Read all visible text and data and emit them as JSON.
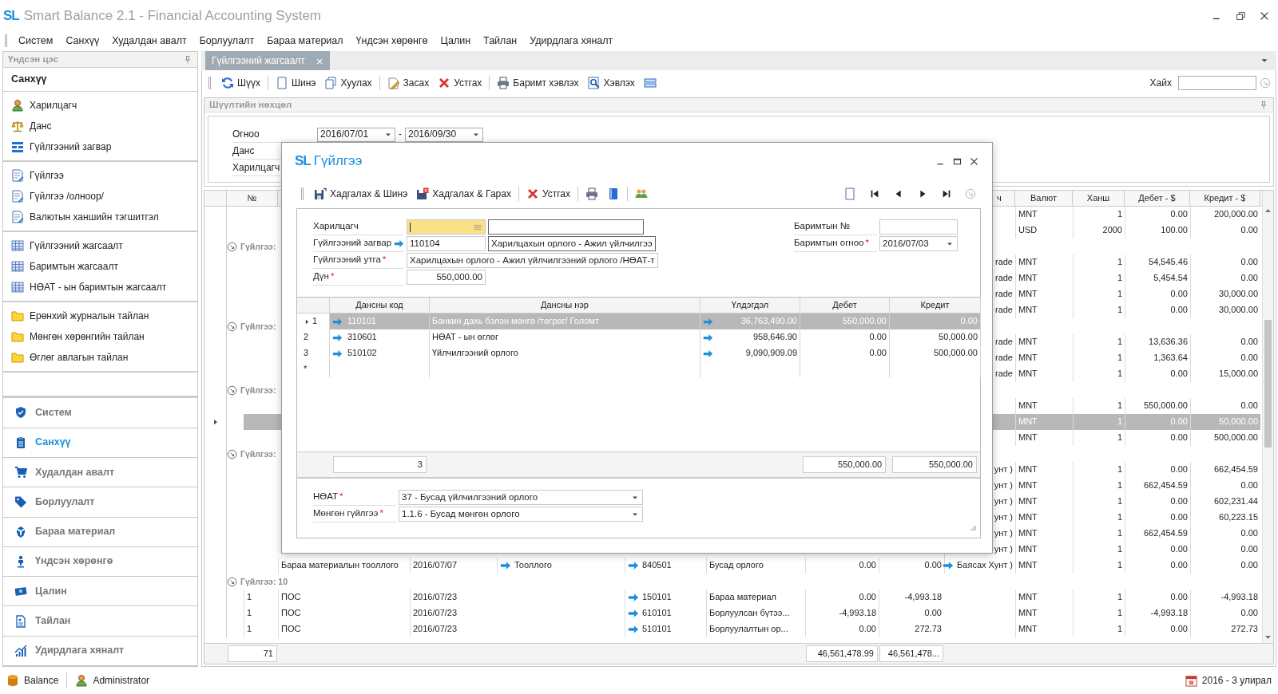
{
  "window": {
    "logo": "SL",
    "title": "Smart Balance 2.1 - Financial Accounting System"
  },
  "menu": [
    "Систем",
    "Санхүү",
    "Худалдан авалт",
    "Борлуулалт",
    "Бараа материал",
    "Үндсэн хөрөнгө",
    "Цалин",
    "Тайлан",
    "Удирдлага хяналт"
  ],
  "sidebar": {
    "header": "Үндсэн цэс",
    "section": "Санхүү",
    "groups": [
      [
        "Харилцагч",
        "Данс",
        "Гүйлгээний загвар"
      ],
      [
        "Гүйлгээ",
        "Гүйлгээ /олноор/",
        "Валютын ханшийн тэгшитгэл"
      ],
      [
        "Гүйлгээний жагсаалт",
        "Баримтын жагсаалт",
        "НӨАТ - ын баримтын жагсаалт"
      ],
      [
        "Ерөнхий журналын тайлан",
        "Мөнгөн хөрөнгийн тайлан",
        "Өглөг авлагын тайлан"
      ]
    ],
    "modules": [
      {
        "label": "Систем",
        "selected": false
      },
      {
        "label": "Санхүү",
        "selected": true
      },
      {
        "label": "Худалдан авалт",
        "selected": false
      },
      {
        "label": "Борлуулалт",
        "selected": false
      },
      {
        "label": "Бараа материал",
        "selected": false
      },
      {
        "label": "Үндсэн хөрөнгө",
        "selected": false
      },
      {
        "label": "Цалин",
        "selected": false
      },
      {
        "label": "Тайлан",
        "selected": false
      },
      {
        "label": "Удирдлага хяналт",
        "selected": false
      }
    ]
  },
  "tabs": [
    {
      "label": "Гүйлгээний жагсаалт",
      "close": "×",
      "selected": true
    }
  ],
  "toolbar": {
    "groups": [
      [
        "Шүүх"
      ],
      [
        "Шинэ",
        "Хуулах"
      ],
      [
        "Засах",
        "Устгах"
      ],
      [
        "Баримт хэвлэх",
        "Хэвлэх"
      ]
    ],
    "search_label": "Хайх"
  },
  "filter": {
    "title": "Шүүлтийн нөхцөл",
    "fields": [
      {
        "label": "Огноо",
        "from": "2016/07/01",
        "separator": "-",
        "to": "2016/09/30"
      },
      {
        "label": "Данс"
      },
      {
        "label": "Харилцагч"
      }
    ]
  },
  "grid": {
    "header": {
      "no": "№",
      "column_9": "ч",
      "currency": "Валют",
      "rate": "Ханш",
      "debit_usd": "Дебет - $",
      "credit_usd": "Кредит - $"
    },
    "rows": [
      {
        "kind": "row",
        "selected": false,
        "currency": "MNT",
        "rate": "1",
        "debit_usd": "0.00",
        "credit_usd": "200,000.00"
      },
      {
        "kind": "row",
        "selected": false,
        "currency": "USD",
        "rate": "2000",
        "debit_usd": "100.00",
        "credit_usd": "0.00"
      },
      {
        "kind": "group",
        "label": "Гүйлгээ:"
      },
      {
        "kind": "row",
        "selected": false,
        "column_9": "rade",
        "currency": "MNT",
        "rate": "1",
        "debit_usd": "54,545.46",
        "credit_usd": "0.00"
      },
      {
        "kind": "row",
        "selected": false,
        "column_9": "rade",
        "currency": "MNT",
        "rate": "1",
        "debit_usd": "5,454.54",
        "credit_usd": "0.00"
      },
      {
        "kind": "row",
        "selected": false,
        "column_9": "rade",
        "currency": "MNT",
        "rate": "1",
        "debit_usd": "0.00",
        "credit_usd": "30,000.00"
      },
      {
        "kind": "row",
        "selected": false,
        "column_9": "rade",
        "currency": "MNT",
        "rate": "1",
        "debit_usd": "0.00",
        "credit_usd": "30,000.00"
      },
      {
        "kind": "group",
        "label": "Гүйлгээ:"
      },
      {
        "kind": "row",
        "selected": false,
        "column_9": "rade",
        "currency": "MNT",
        "rate": "1",
        "debit_usd": "13,636.36",
        "credit_usd": "0.00"
      },
      {
        "kind": "row",
        "selected": false,
        "column_9": "rade",
        "currency": "MNT",
        "rate": "1",
        "debit_usd": "1,363.64",
        "credit_usd": "0.00"
      },
      {
        "kind": "row",
        "selected": false,
        "column_9": "rade",
        "currency": "MNT",
        "rate": "1",
        "debit_usd": "0.00",
        "credit_usd": "15,000.00"
      },
      {
        "kind": "group",
        "label": "Гүйлгээ:"
      },
      {
        "kind": "row",
        "selected": false,
        "currency": "MNT",
        "rate": "1",
        "debit_usd": "550,000.00",
        "credit_usd": "0.00"
      },
      {
        "kind": "row",
        "selected": true,
        "currency": "MNT",
        "rate": "1",
        "debit_usd": "0.00",
        "credit_usd": "50,000.00"
      },
      {
        "kind": "row",
        "selected": false,
        "currency": "MNT",
        "rate": "1",
        "debit_usd": "0.00",
        "credit_usd": "500,000.00"
      },
      {
        "kind": "group",
        "label": "Гүйлгээ:"
      },
      {
        "kind": "row",
        "selected": false,
        "column_9": "унт )",
        "currency": "MNT",
        "rate": "1",
        "debit_usd": "0.00",
        "credit_usd": "662,454.59"
      },
      {
        "kind": "row",
        "selected": false,
        "column_9": "унт )",
        "currency": "MNT",
        "rate": "1",
        "debit_usd": "662,454.59",
        "credit_usd": "0.00"
      },
      {
        "kind": "row",
        "selected": false,
        "column_9": "унт )",
        "currency": "MNT",
        "rate": "1",
        "debit_usd": "0.00",
        "credit_usd": "602,231.44"
      },
      {
        "kind": "row",
        "selected": false,
        "column_9": "унт )",
        "currency": "MNT",
        "rate": "1",
        "debit_usd": "0.00",
        "credit_usd": "60,223.15"
      },
      {
        "kind": "row",
        "selected": false,
        "column_9": "унт )",
        "currency": "MNT",
        "rate": "1",
        "debit_usd": "662,454.59",
        "credit_usd": "0.00"
      },
      {
        "kind": "row",
        "selected": false,
        "column_9": "унт )",
        "currency": "MNT",
        "rate": "1",
        "debit_usd": "0.00",
        "credit_usd": "0.00"
      },
      {
        "kind": "row",
        "selected": false,
        "column_2": "Бараа материалын тооллого",
        "column_3": "2016/07/07",
        "column_4": "Тооллого",
        "column_5": "840501",
        "column_6": "Бусад орлого",
        "column_7": "0.00",
        "column_8": "0.00",
        "column_9": "Баясах Хунт )",
        "currency": "MNT",
        "rate": "1",
        "debit_usd": "0.00",
        "credit_usd": "0.00"
      },
      {
        "kind": "group",
        "label": "Гүйлгээ: 10"
      },
      {
        "kind": "row",
        "selected": false,
        "no": "1",
        "column_2": "ПОС",
        "column_3": "2016/07/23",
        "column_5": "150101",
        "column_6": "Бараа материал",
        "column_7": "0.00",
        "column_8": "-4,993.18",
        "currency": "MNT",
        "rate": "1",
        "debit_usd": "0.00",
        "credit_usd": "-4,993.18"
      },
      {
        "kind": "row",
        "selected": false,
        "no": "1",
        "column_2": "ПОС",
        "column_3": "2016/07/23",
        "column_5": "610101",
        "column_6": "Борлуулсан бүтээ...",
        "column_7": "-4,993.18",
        "column_8": "0.00",
        "currency": "MNT",
        "rate": "1",
        "debit_usd": "-4,993.18",
        "credit_usd": "0.00"
      },
      {
        "kind": "row",
        "selected": false,
        "no": "1",
        "column_2": "ПОС",
        "column_3": "2016/07/23",
        "column_5": "510101",
        "column_6": "Борлуулалтын ор...",
        "column_7": "0.00",
        "column_8": "272.73",
        "currency": "MNT",
        "rate": "1",
        "debit_usd": "0.00",
        "credit_usd": "272.73"
      }
    ],
    "footer": {
      "count": "71",
      "column_7": "46,561,478.99",
      "column_8": "46,561,478..."
    }
  },
  "dialog": {
    "logo": "SL",
    "title": "Гүйлгээ",
    "toolbar": [
      "Хадгалах & Шинэ",
      "Хадгалах & Гарах",
      "Устгах"
    ],
    "fields": [
      {
        "label": "Харилцагч",
        "kind": "lookup",
        "focused": true
      },
      {
        "label": "Гүйлгээний загвар",
        "kind": "link",
        "code": "110104",
        "name": "Харилцахын орлого - Ажил үйлчилгээ",
        "focused": false
      },
      {
        "label": "Гүйлгээний утга",
        "mark": "*",
        "kind": "text",
        "value": "Харилцахын орлого - Ажил үйлчилгээний орлого /НӨАТ-т",
        "focused": false
      },
      {
        "label": "Дүн",
        "mark": "*",
        "kind": "amount",
        "value": "550,000.00",
        "focused": false
      }
    ],
    "side_fields": [
      {
        "label": "Баримтын №",
        "kind": "text"
      },
      {
        "label": "Баримтын огноо",
        "mark": "*",
        "kind": "date",
        "value": "2016/07/03"
      }
    ],
    "grid": {
      "columns": [
        "Дансны код",
        "Дансны нэр",
        "Үлдэгдэл",
        "Дебет",
        "Кредит"
      ],
      "rows": [
        {
          "no": "1",
          "code": "110101",
          "name": "Банкин дахь бэлэн мөнгө /төгрөг/ Голомт",
          "balance": "36,763,490.00",
          "debit": "550,000.00",
          "credit": "0.00",
          "selected": true
        },
        {
          "no": "2",
          "code": "310601",
          "name": "НӨАТ - ын өглөг",
          "balance": "958,646.90",
          "debit": "0.00",
          "credit": "50,000.00",
          "selected": false
        },
        {
          "no": "3",
          "code": "510102",
          "name": "Үйлчилгээний орлого",
          "balance": "9,090,909.09",
          "debit": "0.00",
          "credit": "500,000.00",
          "selected": false
        }
      ],
      "new_row": "*",
      "footer": {
        "count": "3",
        "debit": "550,000.00",
        "credit": "550,000.00"
      }
    },
    "bottom_fields": [
      {
        "label": "НӨАТ",
        "mark": "*",
        "value": "37 - Бусад үйлчилгээний орлого"
      },
      {
        "label": "Мөнгөн гүйлгээ",
        "mark": "*",
        "value": "1.1.6 - Бусад мөнгөн орлого"
      }
    ]
  },
  "status_bar": {
    "items": [
      "Balance",
      "Administrator"
    ],
    "period": "2016 - 3 улирал"
  }
}
